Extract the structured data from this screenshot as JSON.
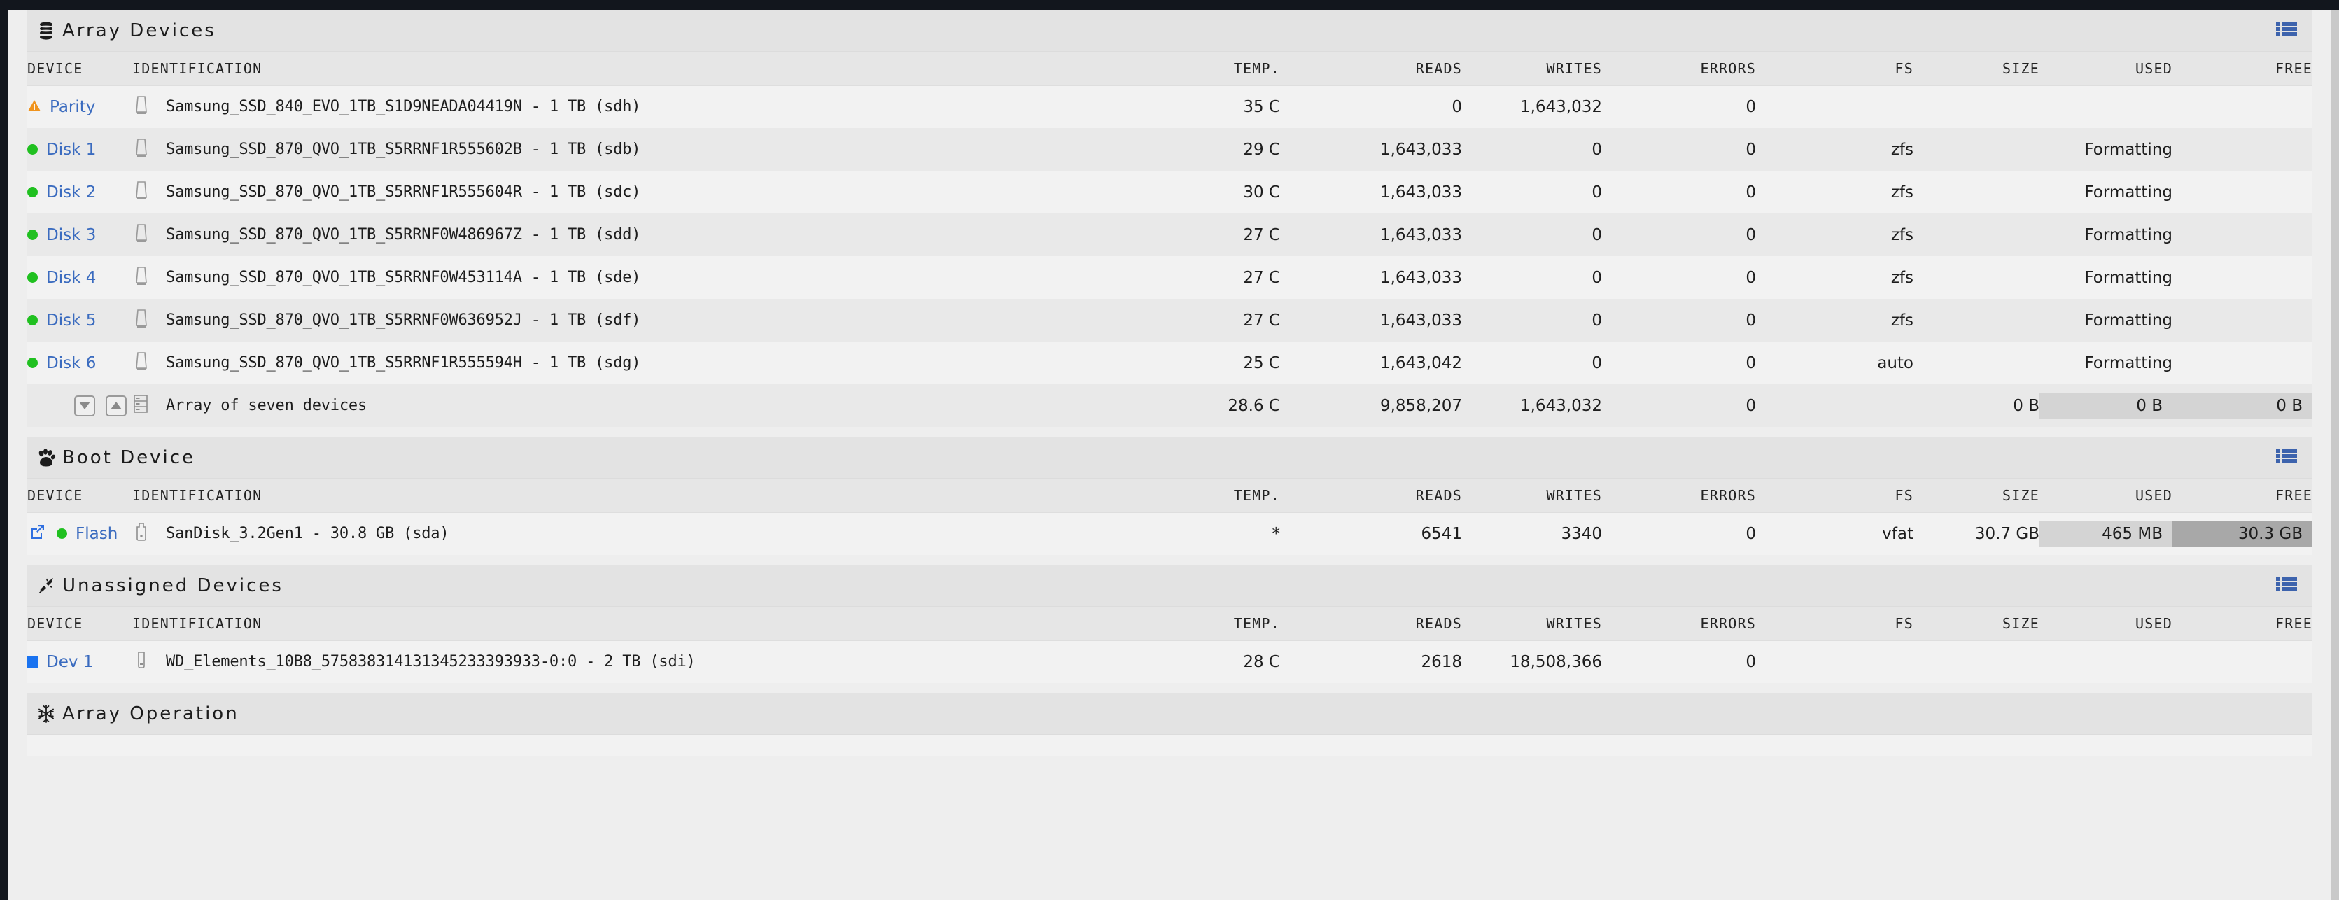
{
  "theme": {
    "accent_blue": "#3a6bbf",
    "list_icon_blue": "#3d63ad",
    "status_green": "#20c020",
    "status_blue": "#1a73f0",
    "warning_orange": "#f0941e",
    "page_bg": "#eeeeee",
    "header_bg": "#e3e3e3",
    "row_odd_bg": "#f2f2f2",
    "row_even_bg": "#e9e9e9",
    "bar_light": "#d4d4d4",
    "bar_dark": "#a8a8a8"
  },
  "columns": {
    "device": "DEVICE",
    "identification": "IDENTIFICATION",
    "temp": "TEMP.",
    "reads": "READS",
    "writes": "WRITES",
    "errors": "ERRORS",
    "fs": "FS",
    "size": "SIZE",
    "used": "USED",
    "free": "FREE"
  },
  "sections": {
    "array_devices": {
      "title": "Array Devices",
      "icon": "database-stack-icon",
      "toggle_icon": "list-view-icon",
      "rows": [
        {
          "device": "Parity",
          "status_icon": "warning-triangle-icon",
          "identification": "Samsung_SSD_840_EVO_1TB_S1D9NEADA04419N - 1 TB (sdh)",
          "temp": "35 C",
          "reads": "0",
          "writes": "1,643,032",
          "errors": "0",
          "fs": "",
          "size": "",
          "used": "",
          "free": ""
        },
        {
          "device": "Disk 1",
          "status_icon": "green-dot-icon",
          "identification": "Samsung_SSD_870_QVO_1TB_S5RRNF1R555602B - 1 TB (sdb)",
          "temp": "29 C",
          "reads": "1,643,033",
          "writes": "0",
          "errors": "0",
          "fs": "zfs",
          "size": "",
          "used": "Formatting",
          "free": ""
        },
        {
          "device": "Disk 2",
          "status_icon": "green-dot-icon",
          "identification": "Samsung_SSD_870_QVO_1TB_S5RRNF1R555604R - 1 TB (sdc)",
          "temp": "30 C",
          "reads": "1,643,033",
          "writes": "0",
          "errors": "0",
          "fs": "zfs",
          "size": "",
          "used": "Formatting",
          "free": ""
        },
        {
          "device": "Disk 3",
          "status_icon": "green-dot-icon",
          "identification": "Samsung_SSD_870_QVO_1TB_S5RRNF0W486967Z - 1 TB (sdd)",
          "temp": "27 C",
          "reads": "1,643,033",
          "writes": "0",
          "errors": "0",
          "fs": "zfs",
          "size": "",
          "used": "Formatting",
          "free": ""
        },
        {
          "device": "Disk 4",
          "status_icon": "green-dot-icon",
          "identification": "Samsung_SSD_870_QVO_1TB_S5RRNF0W453114A - 1 TB (sde)",
          "temp": "27 C",
          "reads": "1,643,033",
          "writes": "0",
          "errors": "0",
          "fs": "zfs",
          "size": "",
          "used": "Formatting",
          "free": ""
        },
        {
          "device": "Disk 5",
          "status_icon": "green-dot-icon",
          "identification": "Samsung_SSD_870_QVO_1TB_S5RRNF0W636952J - 1 TB (sdf)",
          "temp": "27 C",
          "reads": "1,643,033",
          "writes": "0",
          "errors": "0",
          "fs": "zfs",
          "size": "",
          "used": "Formatting",
          "free": ""
        },
        {
          "device": "Disk 6",
          "status_icon": "green-dot-icon",
          "identification": "Samsung_SSD_870_QVO_1TB_S5RRNF1R555594H - 1 TB (sdg)",
          "temp": "25 C",
          "reads": "1,643,042",
          "writes": "0",
          "errors": "0",
          "fs": "auto",
          "size": "",
          "used": "Formatting",
          "free": ""
        }
      ],
      "summary": {
        "identification": "Array of seven devices",
        "icon": "server-rack-icon",
        "spin_down_icon": "triangle-down-icon",
        "spin_up_icon": "triangle-up-icon",
        "temp": "28.6 C",
        "reads": "9,858,207",
        "writes": "1,643,032",
        "errors": "0",
        "fs": "",
        "size": "0 B",
        "used": "0 B",
        "free": "0 B"
      }
    },
    "boot_device": {
      "title": "Boot Device",
      "icon": "paw-print-icon",
      "toggle_icon": "list-view-icon",
      "rows": [
        {
          "device": "Flash",
          "status_icon": "green-dot-icon",
          "link_icon": "external-link-icon",
          "identification": "SanDisk_3.2Gen1 - 30.8 GB (sda)",
          "temp": "*",
          "reads": "6541",
          "writes": "3340",
          "errors": "0",
          "fs": "vfat",
          "size": "30.7 GB",
          "used": "465 MB",
          "free": "30.3 GB"
        }
      ]
    },
    "unassigned_devices": {
      "title": "Unassigned Devices",
      "icon": "unplugged-icon",
      "toggle_icon": "list-view-icon",
      "rows": [
        {
          "device": "Dev 1",
          "status_icon": "blue-square-icon",
          "identification": "WD_Elements_10B8_575838314131345233393933-0:0 - 2 TB (sdi)",
          "temp": "28 C",
          "reads": "2618",
          "writes": "18,508,366",
          "errors": "0",
          "fs": "",
          "size": "",
          "used": "",
          "free": ""
        }
      ]
    },
    "array_operation": {
      "title": "Array Operation",
      "icon": "snowflake-icon"
    }
  }
}
